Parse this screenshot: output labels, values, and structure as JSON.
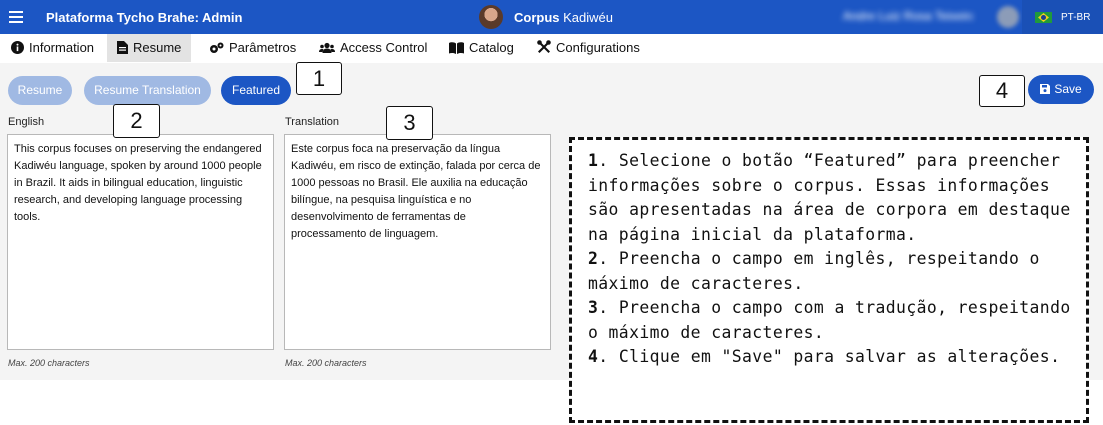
{
  "header": {
    "menu_icon": "hamburger-icon",
    "app_title": "Plataforma Tycho Brahe: Admin",
    "corpus_label": "Corpus",
    "corpus_name": "Kadiwéu",
    "user_name": "Andre Luiz Rosa Teixeira",
    "language_flag": "brazil-flag-icon",
    "language": "PT-BR",
    "bar_color": "#1c56c4"
  },
  "tabs": [
    {
      "label": "Information",
      "icon": "info-circle-icon"
    },
    {
      "label": "Resume",
      "icon": "file-icon",
      "active": true
    },
    {
      "label": "Parâmetros",
      "icon": "gears-icon"
    },
    {
      "label": "Access Control",
      "icon": "users-icon"
    },
    {
      "label": "Catalog",
      "icon": "book-icon"
    },
    {
      "label": "Configurations",
      "icon": "tools-icon"
    }
  ],
  "toolbar": {
    "resume_label": "Resume",
    "resume_translation_label": "Resume Translation",
    "featured_label": "Featured",
    "save_label": "Save",
    "save_icon": "floppy-disk-icon"
  },
  "english": {
    "label": "English",
    "text": "This corpus focuses on preserving the endangered Kadiwéu language, spoken by around 1000 people in Brazil. It aids in bilingual education, linguistic research, and developing language processing tools.",
    "hint": "Max. 200 characters"
  },
  "translation": {
    "label": "Translation",
    "text": "Este corpus foca na preservação da língua Kadiwéu, em risco de extinção, falada por cerca de 1000 pessoas no Brasil. Ele auxilia na educação bilíngue, na pesquisa linguística e no desenvolvimento de ferramentas de processamento de linguagem.",
    "hint": "Max. 200 characters"
  },
  "callouts": {
    "c1": "1",
    "c2": "2",
    "c3": "3",
    "c4": "4"
  },
  "instructions": [
    {
      "num": "1",
      "text": ". Selecione o botão “Featured” para preencher informações sobre o corpus. Essas informações são apresentadas na área de corpora em destaque na página inicial da plataforma."
    },
    {
      "num": "2",
      "text": ". Preencha o campo em inglês, respeitando o máximo de caracteres."
    },
    {
      "num": "3",
      "text": ". Preencha o campo com a tradução, respeitando o máximo de caracteres."
    },
    {
      "num": "4",
      "text": ". Clique em \"Save\" para salvar as alterações."
    }
  ]
}
